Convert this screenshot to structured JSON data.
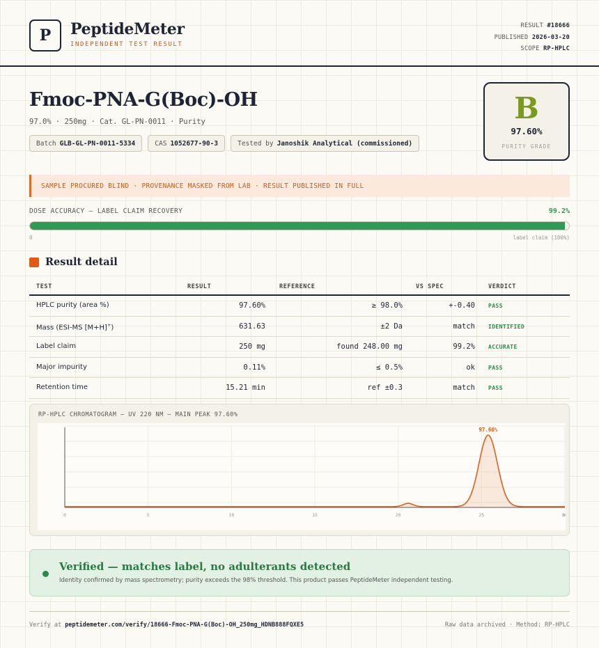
{
  "header": {
    "logo_letter": "P",
    "brand": "PeptideMeter",
    "brand_sub": "INDEPENDENT TEST RESULT",
    "result_label": "RESULT",
    "result_value": "#18666",
    "published_label": "PUBLISHED",
    "published_value": "2026-03-20",
    "scope_label": "SCOPE",
    "scope_value": "RP-HPLC"
  },
  "product": {
    "title": "Fmoc-PNA-G(Boc)-OH",
    "subtitle": "97.0% · 250mg · Cat. GL-PN-0011 · Purity",
    "chips": [
      {
        "label": "Batch",
        "value": "GLB-GL-PN-0011-5334"
      },
      {
        "label": "CAS",
        "value": "1052677-90-3"
      },
      {
        "label": "Tested by",
        "value": "Janoshik Analytical (commissioned)"
      }
    ]
  },
  "grade": {
    "letter": "B",
    "value": "97.60%",
    "label": "PURITY GRADE",
    "color": "#7a9a1e"
  },
  "notice": "SAMPLE PROCURED BLIND · PROVENANCE MASKED FROM LAB · RESULT PUBLISHED IN FULL",
  "dose": {
    "label": "DOSE ACCURACY — LABEL CLAIM RECOVERY",
    "value": "99.2%",
    "fraction": 0.992,
    "min_label": "0",
    "max_label": "label claim (100%)"
  },
  "section_title": "Result detail",
  "table": {
    "headers": [
      "TEST",
      "RESULT",
      "REFERENCE",
      "VS SPEC",
      "VERDICT"
    ],
    "rows": [
      {
        "test": "HPLC purity (area %)",
        "result": "97.60%",
        "reference": "≥ 98.0%",
        "vs": "+-0.40",
        "verdict": "PASS"
      },
      {
        "test": "Mass (ESI-MS [M+H]",
        "test_sup": "+",
        "test_end": ")",
        "result": "631.63",
        "reference": "±2 Da",
        "vs": "match",
        "verdict": "IDENTIFIED"
      },
      {
        "test": "Label claim",
        "result": "250 mg",
        "reference": "found 248.00 mg",
        "vs": "99.2%",
        "verdict": "ACCURATE"
      },
      {
        "test": "Major impurity",
        "result": "0.11%",
        "reference": "≤ 0.5%",
        "vs": "ok",
        "verdict": "PASS"
      },
      {
        "test": "Retention time",
        "result": "15.21 min",
        "reference": "ref ±0.3",
        "vs": "match",
        "verdict": "PASS"
      }
    ]
  },
  "chart_data": {
    "type": "line",
    "title": "RP-HPLC CHROMATOGRAM — UV 220 NM — MAIN PEAK 97.60%",
    "xlabel": "",
    "ylabel": "",
    "xlim": [
      0,
      30
    ],
    "x_ticks": [
      "0",
      "5",
      "10",
      "15",
      "20",
      "25",
      "30"
    ],
    "x_unit": "min",
    "baseline": 0.01,
    "peaks": [
      {
        "x": 20.6,
        "height": 0.045,
        "width": 0.3
      },
      {
        "x": 25.4,
        "height": 0.96,
        "width": 0.55,
        "label": "97.60%"
      }
    ],
    "color": "#d9621c"
  },
  "verified": {
    "title": "Verified — matches label, no adulterants detected",
    "text": "Identity confirmed by mass spectrometry; purity exceeds the 98% threshold. This product passes PeptideMeter independent testing."
  },
  "footer": {
    "verify_prefix": "Verify at",
    "verify_url": "peptidemeter.com/verify/18666-Fmoc-PNA-G(Boc)-OH_250mg_HDNB888FQXE5",
    "right": "Raw data archived · Method: RP-HPLC"
  }
}
